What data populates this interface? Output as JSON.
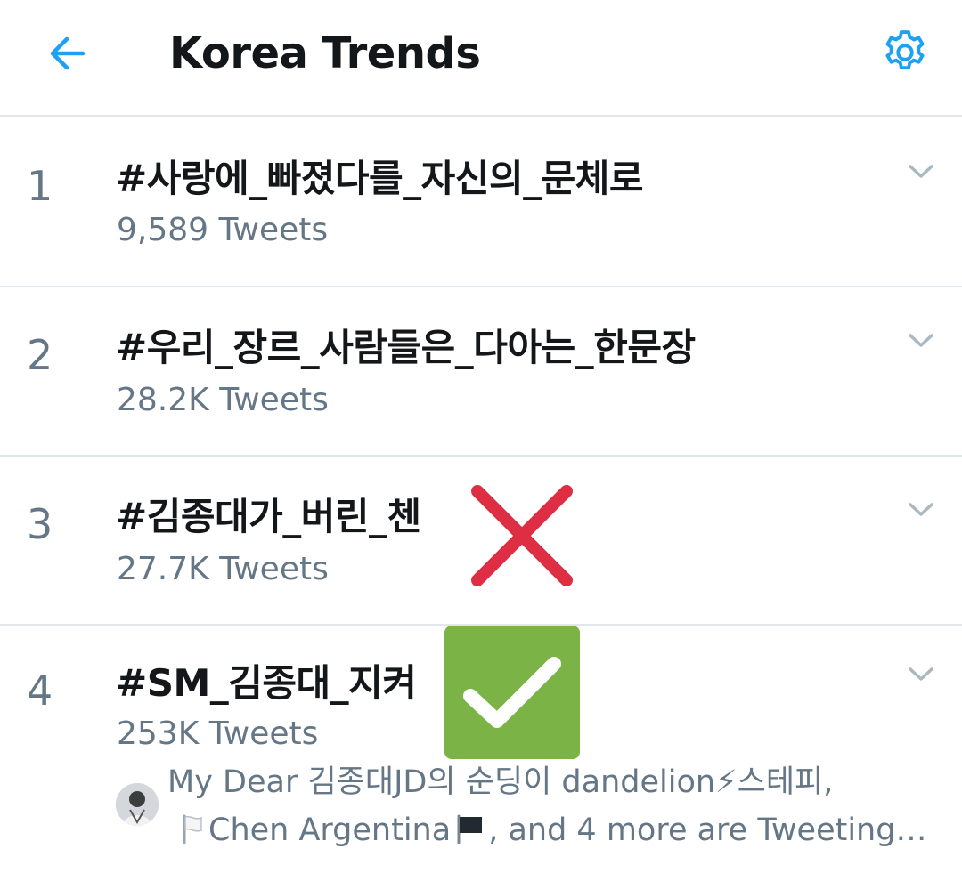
{
  "header": {
    "title": "Korea Trends",
    "back_icon": "arrow-left-icon",
    "settings_icon": "gear-icon",
    "accent_color": "#1da1f2"
  },
  "trends": [
    {
      "rank": "1",
      "name": "#사랑에_빠졌다를_자신의_문체로",
      "tweets": "9,589 Tweets"
    },
    {
      "rank": "2",
      "name": "#우리_장르_사람들은_다아는_한문장",
      "tweets": "28.2K Tweets"
    },
    {
      "rank": "3",
      "name": "#김종대가_버린_첸",
      "tweets": "27.7K Tweets"
    },
    {
      "rank": "4",
      "name": "#SM_김종대_지켜",
      "tweets": "253K Tweets"
    }
  ],
  "trend4_context": {
    "line1": "My Dear 김종대JD의 순딩이 dandelion⚡스테피,",
    "line2_part1": "Chen Argentina",
    "line2_part2": ", and 4 more are Tweeting…"
  },
  "annotations": {
    "x_mark_color": "#dd2e44",
    "check_bg_color": "#7cb347"
  }
}
